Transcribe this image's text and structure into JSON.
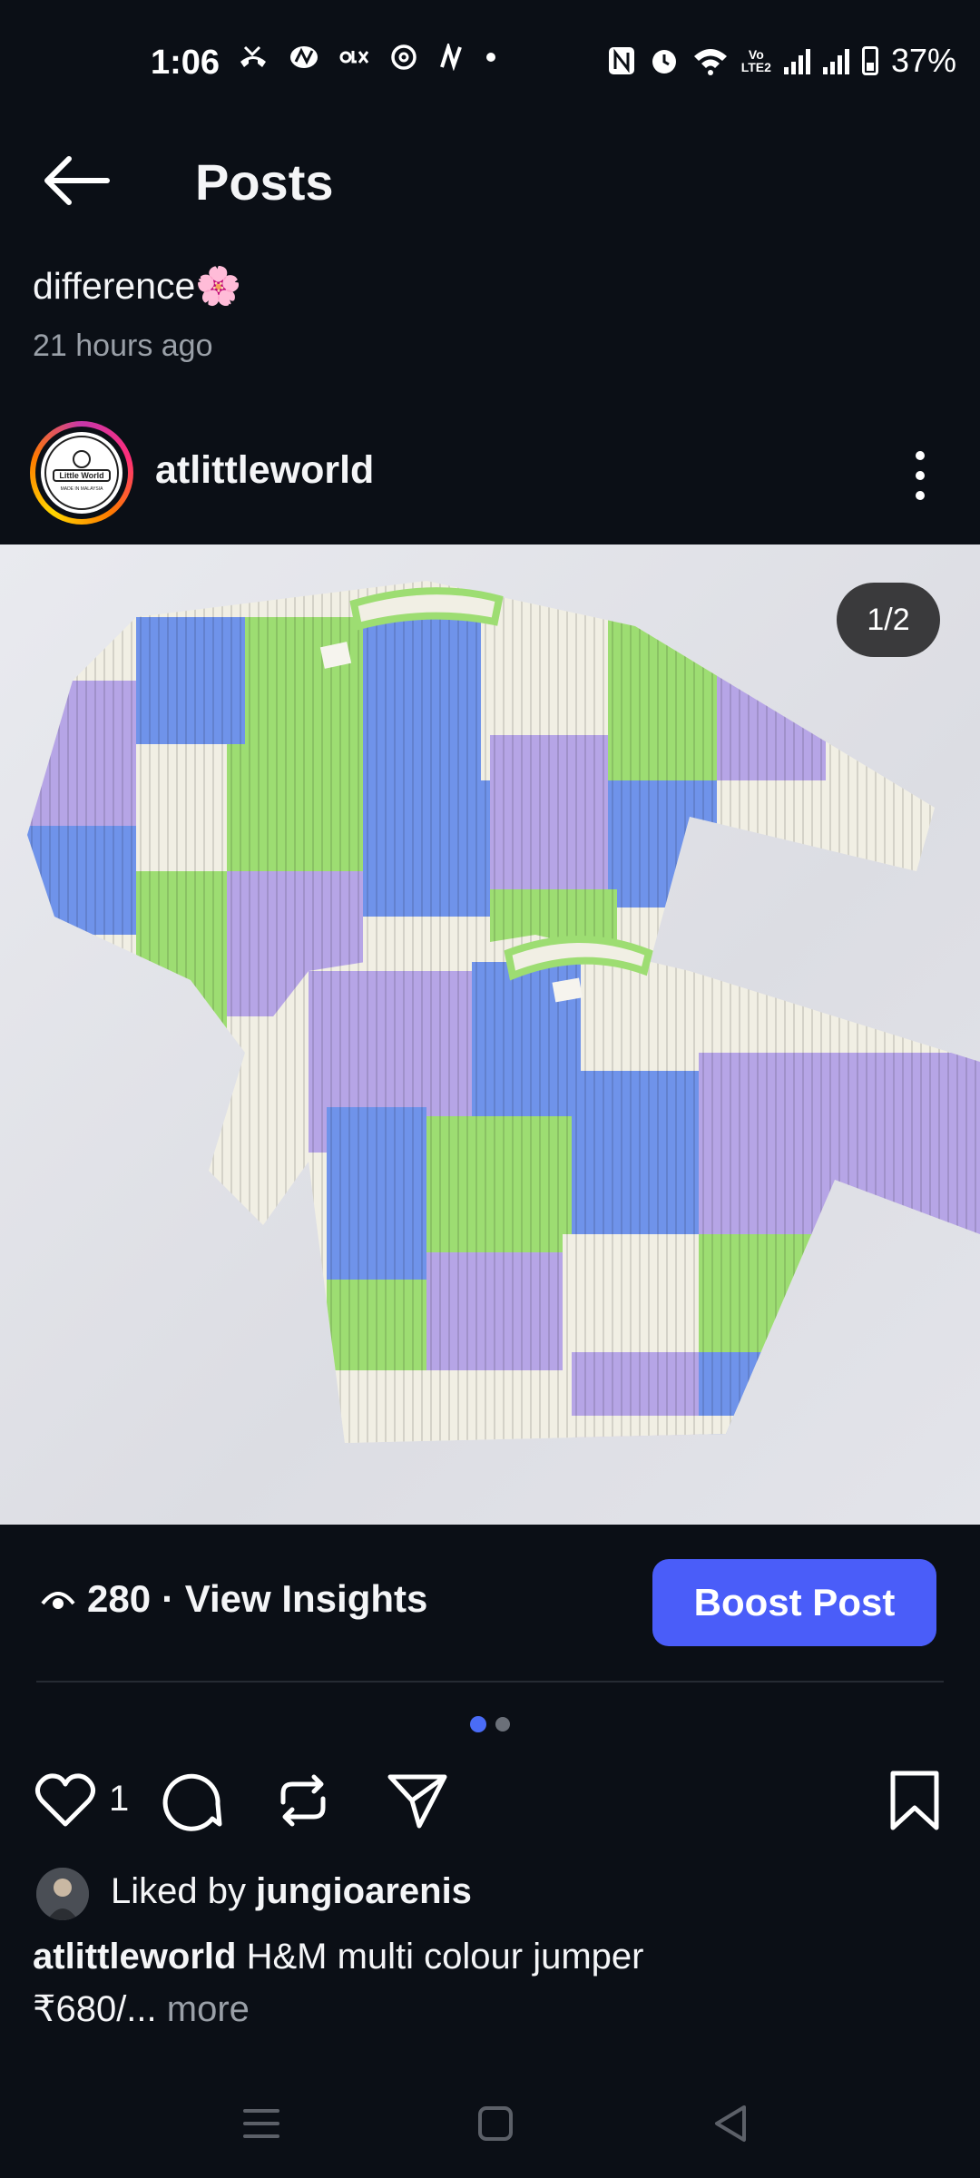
{
  "status_bar": {
    "time": "1:06",
    "volte_top": "Vo",
    "volte_bottom": "LTE2",
    "battery": "37%"
  },
  "header": {
    "title": "Posts"
  },
  "post": {
    "caption_top": "difference🌸",
    "time_ago": "21 hours ago",
    "username": "atlittleworld",
    "avatar_text_top": "Little World",
    "avatar_text_bottom": "MADE IN MALAYSIA",
    "image_counter": "1/2",
    "views": "280",
    "insights_label": "· View Insights",
    "boost_label": "Boost Post",
    "likes_count": "1",
    "liked_by_prefix": "Liked by",
    "liked_by_user": "jungioarenis",
    "caption_user": "atlittleworld",
    "caption_text": "H&M multi colour jumper",
    "caption_line2": "₹680/...",
    "more_label": "more"
  },
  "colors": {
    "background": "#0b0f16",
    "accent": "#4a5df9",
    "dot_active": "#4a6cf7"
  },
  "icons": [
    "back-arrow-icon",
    "eye-icon",
    "heart-icon",
    "comment-icon",
    "repost-icon",
    "share-icon",
    "bookmark-icon",
    "kebab-icon",
    "menu-nav-icon",
    "home-nav-icon",
    "back-nav-icon"
  ]
}
